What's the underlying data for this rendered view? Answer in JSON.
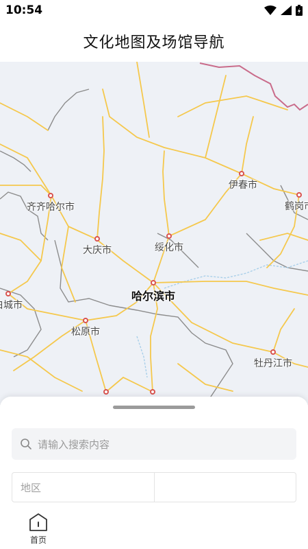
{
  "status_bar": {
    "time": "10:54"
  },
  "header": {
    "title": "文化地图及场馆导航"
  },
  "map": {
    "cities": [
      {
        "name": "齐齐哈尔市",
        "major": false
      },
      {
        "name": "大庆市",
        "major": false
      },
      {
        "name": "绥化市",
        "major": false
      },
      {
        "name": "伊春市",
        "major": false
      },
      {
        "name": "鹤岗市",
        "major": false
      },
      {
        "name": "哈尔滨市",
        "major": true
      },
      {
        "name": "松原市",
        "major": false
      },
      {
        "name": "白城市",
        "major": false
      },
      {
        "name": "牡丹江市",
        "major": false
      }
    ]
  },
  "search": {
    "placeholder": "请输入搜索内容"
  },
  "filters": {
    "region": "地区",
    "category": ""
  },
  "tabs": {
    "home_label": "首页"
  },
  "colors": {
    "road": "#f5c84c",
    "boundary": "#8c8c8c",
    "border": "#c96b8a",
    "city_marker": "#d9534f"
  }
}
